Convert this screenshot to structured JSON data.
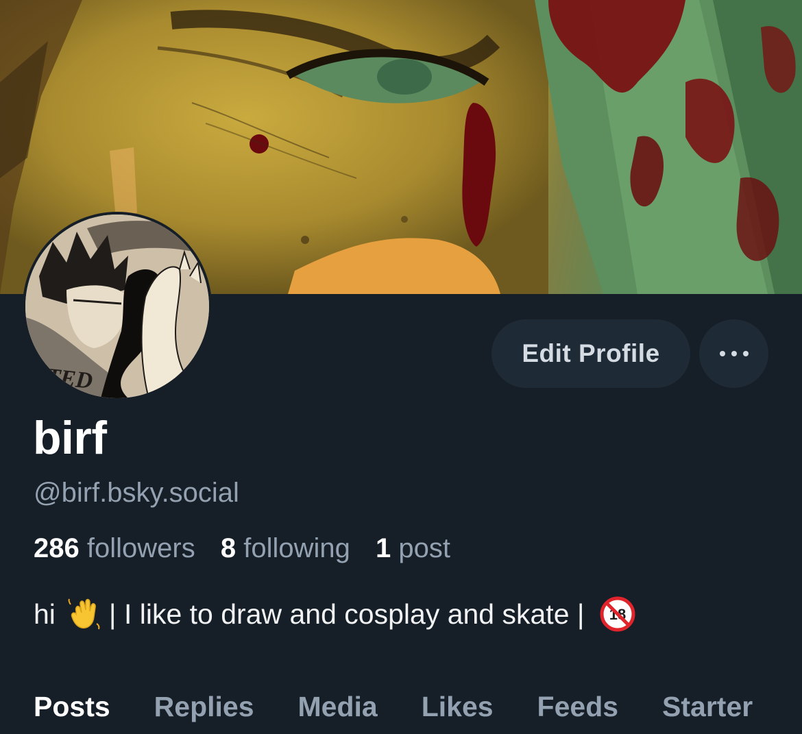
{
  "profile": {
    "display_name": "birf",
    "handle": "@birf.bsky.social",
    "bio_start": "hi",
    "bio_middle": "| I like to draw and cosplay and skate |",
    "bio_emojis": [
      "waving-hand-emoji",
      "no-one-under-eighteen-emoji"
    ]
  },
  "stats": {
    "followers_count": "286",
    "followers_label": "followers",
    "following_count": "8",
    "following_label": "following",
    "posts_count": "1",
    "posts_label": "post"
  },
  "actions": {
    "edit_profile_label": "Edit Profile",
    "more_icon": "ellipsis-icon"
  },
  "tabs": [
    {
      "label": "Posts",
      "active": true
    },
    {
      "label": "Replies",
      "active": false
    },
    {
      "label": "Media",
      "active": false
    },
    {
      "label": "Likes",
      "active": false
    },
    {
      "label": "Feeds",
      "active": false
    },
    {
      "label": "Starter",
      "active": false
    }
  ],
  "avatar": {
    "lettering": "TED"
  },
  "colors": {
    "background": "#161e27",
    "button_bg": "#1e2a36",
    "muted_text": "#93a1b0",
    "primary_text": "#ffffff",
    "blood_red": "#7a0c10"
  }
}
